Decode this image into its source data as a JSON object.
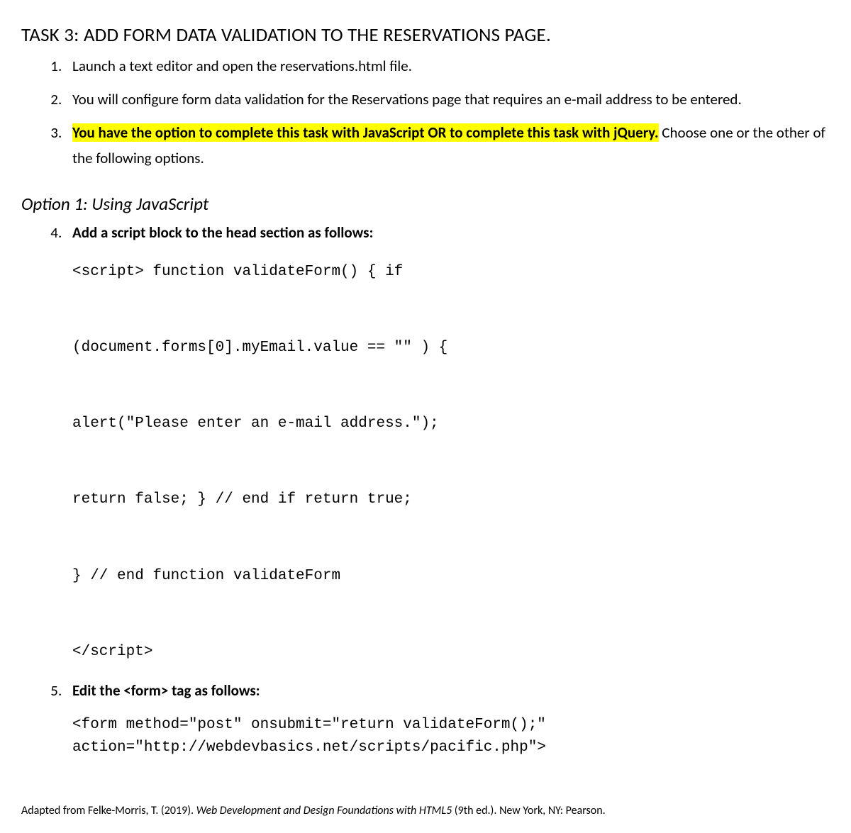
{
  "task_title": "TASK 3: ADD FORM DATA VALIDATION TO THE RESERVATIONS PAGE.",
  "steps": {
    "s1": "Launch a text editor and open the reservations.html file.",
    "s2": "You will configure form data validation for the Reservations page that requires an e-mail address to be entered.",
    "s3_highlight": "You have the option to complete this task with JavaScript OR to complete this task with jQuery.",
    "s3_rest": " Choose one or the other of the following options.",
    "s4": "Add a script block to the head section as follows:",
    "s5": "Edit the <form> tag as follows:"
  },
  "option1_heading": "Option 1: Using JavaScript",
  "code1": {
    "l1": "<script> function validateForm() { if",
    "l2": "(document.forms[0].myEmail.value == \"\" ) {",
    "l3": "alert(\"Please enter an e-mail address.\");",
    "l4": "return false; } // end if return true;",
    "l5": "} // end function validateForm",
    "l6": "</script>"
  },
  "code2": {
    "l1": "<form method=\"post\" onsubmit=\"return validateForm();\"",
    "l2": "action=\"http://webdevbasics.net/scripts/pacific.php\">"
  },
  "citation": {
    "prefix": "Adapted from Felke-Morris, T. (2019). ",
    "title": "Web Development and Design Foundations with HTML5",
    "suffix": " (9th ed.). New York, NY: Pearson."
  }
}
